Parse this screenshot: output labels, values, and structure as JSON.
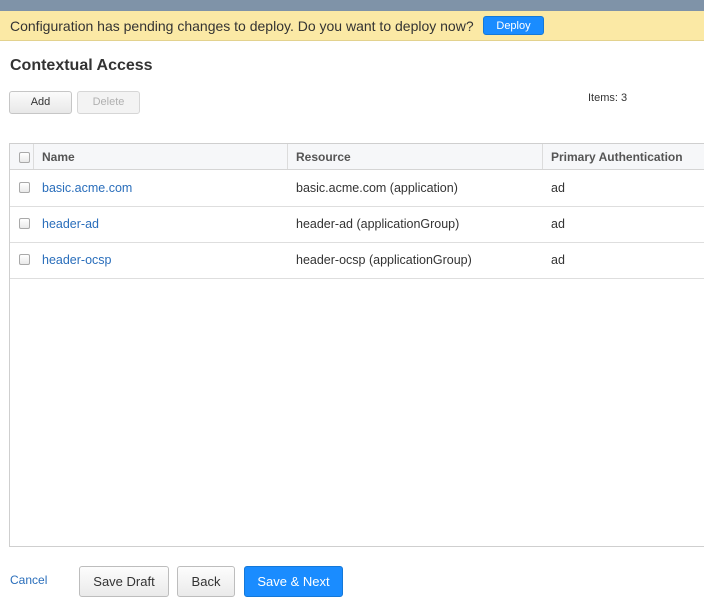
{
  "banner": {
    "message": "Configuration has pending changes to deploy. Do you want to deploy now?",
    "deploy_label": "Deploy"
  },
  "page": {
    "title": "Contextual Access"
  },
  "toolbar": {
    "add_label": "Add",
    "delete_label": "Delete",
    "items_count": "Items: 3"
  },
  "table": {
    "columns": [
      "Name",
      "Resource",
      "Primary Authentication"
    ],
    "rows": [
      {
        "name": "basic.acme.com",
        "resource": "basic.acme.com (application)",
        "primary_auth": "ad"
      },
      {
        "name": "header-ad",
        "resource": "header-ad (applicationGroup)",
        "primary_auth": "ad"
      },
      {
        "name": "header-ocsp",
        "resource": "header-ocsp (applicationGroup)",
        "primary_auth": "ad"
      }
    ]
  },
  "footer": {
    "cancel_label": "Cancel",
    "save_draft_label": "Save Draft",
    "back_label": "Back",
    "save_next_label": "Save & Next"
  },
  "colors": {
    "banner_bg": "#fbe9a5",
    "primary_button": "#1a8cff",
    "link": "#2a6ebb"
  }
}
